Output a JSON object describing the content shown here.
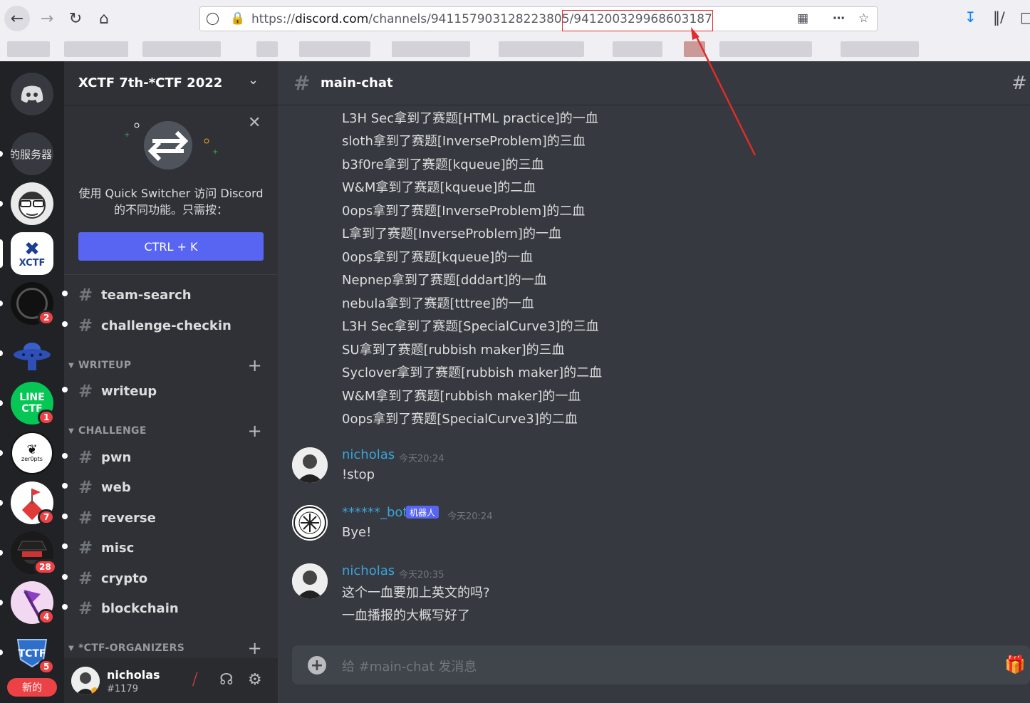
{
  "browser": {
    "url_host_prefix": "https://",
    "url_domain": "discord.com",
    "url_path": "/channels/941157903128223805/",
    "url_highlight": "941200329968603187",
    "icons": {
      "back": "back-arrow-icon",
      "forward": "forward-arrow-icon",
      "reload": "reload-icon",
      "home": "home-icon",
      "shield": "shield-icon",
      "lock": "lock-icon",
      "qr": "qr-code-icon",
      "more": "more-dots-icon",
      "star": "bookmark-star-icon",
      "download": "download-icon",
      "library": "library-icon"
    }
  },
  "rail": {
    "servers": [
      {
        "name": "home",
        "label": ""
      },
      {
        "name": "server-partial",
        "label": "的服务器"
      },
      {
        "name": "server-avatar-sketch",
        "label": ""
      },
      {
        "name": "server-xctf",
        "label": "XCTF"
      },
      {
        "name": "server-dark-logo",
        "badge": "2"
      },
      {
        "name": "server-ufo",
        "label": ""
      },
      {
        "name": "server-line-ctf",
        "label": "LINE CTF",
        "badge": "1"
      },
      {
        "name": "server-zer0pts",
        "label": "zer0pts"
      },
      {
        "name": "server-dice",
        "badge": "7"
      },
      {
        "name": "server-hacker",
        "badge": "28"
      },
      {
        "name": "server-flag",
        "badge": "4"
      },
      {
        "name": "server-tctf",
        "badge": "5"
      }
    ],
    "new_label": "新的"
  },
  "sidebar": {
    "guild_name": "XCTF 7th-*CTF 2022",
    "promo": {
      "text_line1": "使用 Quick Switcher 访问 Discord",
      "text_line2": "的不同功能。只需按：",
      "button": "CTRL + K"
    },
    "channels_top": [
      "team-search",
      "challenge-checkin"
    ],
    "categories": [
      {
        "name": "WRITEUP",
        "channels": [
          "writeup"
        ]
      },
      {
        "name": "CHALLENGE",
        "channels": [
          "pwn",
          "web",
          "reverse",
          "misc",
          "crypto",
          "blockchain"
        ]
      },
      {
        "name": "*CTF-ORGANIZERS",
        "channels": []
      }
    ],
    "user": {
      "name": "nicholas",
      "tag": "#1179"
    }
  },
  "chat": {
    "channel": "main-chat",
    "bot_lines": [
      "L3H Sec拿到了赛题[HTML practice]的一血",
      "sloth拿到了赛题[InverseProblem]的三血",
      "b3f0re拿到了赛题[kqueue]的三血",
      "W&M拿到了赛题[kqueue]的二血",
      "0ops拿到了赛题[InverseProblem]的二血",
      "L拿到了赛题[InverseProblem]的一血",
      "0ops拿到了赛题[kqueue]的一血",
      "Nepnep拿到了赛题[dddart]的一血",
      "nebula拿到了赛题[tttree]的一血",
      "L3H Sec拿到了赛题[SpecialCurve3]的三血",
      "SU拿到了赛题[rubbish maker]的三血",
      "Syclover拿到了赛题[rubbish maker]的二血",
      "W&M拿到了赛题[rubbish maker]的一血",
      "0ops拿到了赛题[SpecialCurve3]的二血"
    ],
    "messages": [
      {
        "author": "nicholas",
        "time": "今天20:24",
        "lines": [
          "!stop"
        ]
      },
      {
        "author": "******_bot",
        "tag": "机器人",
        "time": "今天20:24",
        "lines": [
          "Bye!"
        ]
      },
      {
        "author": "nicholas",
        "time": "今天20:35",
        "lines": [
          "这个一血要加上英文的吗?",
          "一血播报的大概写好了"
        ]
      }
    ],
    "composer_placeholder": "给 #main-chat 发消息"
  },
  "colors": {
    "blurple": "#5865f2",
    "red": "#ed4245",
    "author_blue": "#3ba5dc",
    "annotation_red": "#e22b2b"
  }
}
